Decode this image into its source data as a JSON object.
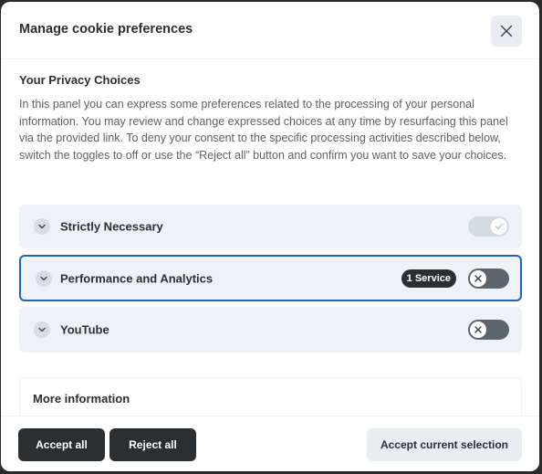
{
  "header": {
    "title": "Manage cookie preferences",
    "close_icon": "close-icon"
  },
  "privacy": {
    "title": "Your Privacy Choices",
    "description": "In this panel you can express some preferences related to the processing of your personal information. You may review and change expressed choices at any time by resurfacing this panel via the provided link. To deny your consent to the specific processing activities described below, switch the toggles to off or use the “Reject all” button and confirm you want to save your choices."
  },
  "categories": [
    {
      "label": "Strictly Necessary",
      "enabled": true,
      "readonly": true,
      "badge": null
    },
    {
      "label": "Performance and Analytics",
      "enabled": false,
      "readonly": false,
      "badge": "1 Service",
      "focused": true
    },
    {
      "label": "YouTube",
      "enabled": false,
      "readonly": false,
      "badge": null
    }
  ],
  "more_info": {
    "label": "More information"
  },
  "footer": {
    "accept_all": "Accept all",
    "reject_all": "Reject all",
    "accept_selection": "Accept current selection"
  },
  "colors": {
    "focus_ring": "#1e63c2",
    "primary_button": "#2c2f31",
    "secondary_button": "#e9edf1",
    "category_bg": "#eef1f5",
    "toggle_off": "#5c656d",
    "toggle_disabled": "#d2dbdf"
  }
}
